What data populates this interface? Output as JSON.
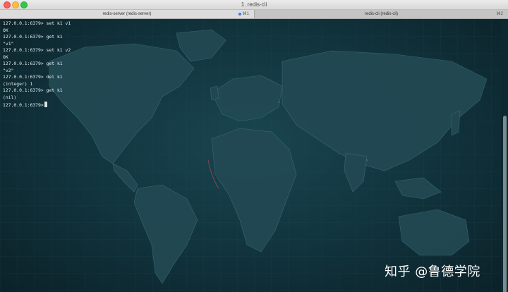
{
  "window": {
    "title": "1. redis-cli"
  },
  "tabs": [
    {
      "label": "redis-server (redis-server)",
      "shortcut": "⌘1",
      "active": true
    },
    {
      "label": "redis-cli (redis-cli)",
      "shortcut": "⌘2",
      "active": false
    }
  ],
  "terminal": {
    "lines": [
      "127.0.0.1:6379> set k1 v1",
      "OK",
      "127.0.0.1:6379> get k1",
      "\"v1\"",
      "127.0.0.1:6379> set k1 v2",
      "OK",
      "127.0.0.1:6379> get k1",
      "\"v2\"",
      "127.0.0.1:6379> del k1",
      "(integer) 1",
      "127.0.0.1:6379> get k1",
      "(nil)"
    ],
    "prompt": "127.0.0.1:6379>"
  },
  "watermark": "知乎 @鲁德学院",
  "colors": {
    "background": "#0f2a33",
    "text": "#e6eef0",
    "tab_indicator": "#3b7de0"
  }
}
